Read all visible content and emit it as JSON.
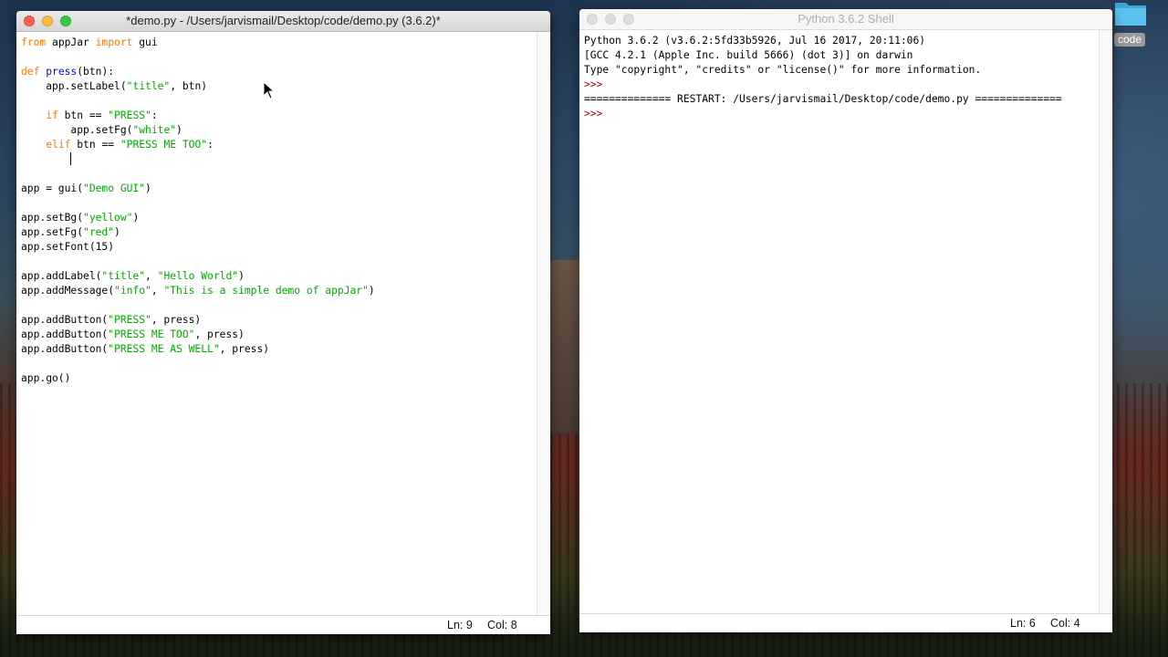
{
  "desktop": {
    "folder_label": "code"
  },
  "editor": {
    "title": "*demo.py - /Users/jarvismail/Desktop/code/demo.py (3.6.2)*",
    "lines": [
      [
        {
          "t": "from",
          "c": "kw"
        },
        {
          "t": " appJar "
        },
        {
          "t": "import",
          "c": "kw"
        },
        {
          "t": " gui"
        }
      ],
      [],
      [
        {
          "t": "def",
          "c": "kw"
        },
        {
          "t": " "
        },
        {
          "t": "press",
          "c": "def"
        },
        {
          "t": "(btn):"
        }
      ],
      [
        {
          "t": "    app.setLabel("
        },
        {
          "t": "\"title\"",
          "c": "str"
        },
        {
          "t": ", btn)"
        }
      ],
      [],
      [
        {
          "t": "    "
        },
        {
          "t": "if",
          "c": "kw"
        },
        {
          "t": " btn == "
        },
        {
          "t": "\"PRESS\"",
          "c": "str"
        },
        {
          "t": ":"
        }
      ],
      [
        {
          "t": "        app.setFg("
        },
        {
          "t": "\"white\"",
          "c": "str"
        },
        {
          "t": ")"
        }
      ],
      [
        {
          "t": "    "
        },
        {
          "t": "elif",
          "c": "kw"
        },
        {
          "t": " btn == "
        },
        {
          "t": "\"PRESS ME TOO\"",
          "c": "str"
        },
        {
          "t": ":"
        }
      ],
      [
        {
          "t": "        "
        },
        {
          "t": "",
          "c": "cursor"
        }
      ],
      [],
      [
        {
          "t": "app = gui("
        },
        {
          "t": "\"Demo GUI\"",
          "c": "str"
        },
        {
          "t": ")"
        }
      ],
      [],
      [
        {
          "t": "app.setBg("
        },
        {
          "t": "\"yellow\"",
          "c": "str"
        },
        {
          "t": ")"
        }
      ],
      [
        {
          "t": "app.setFg("
        },
        {
          "t": "\"red\"",
          "c": "str"
        },
        {
          "t": ")"
        }
      ],
      [
        {
          "t": "app.setFont(15)"
        }
      ],
      [],
      [
        {
          "t": "app.addLabel("
        },
        {
          "t": "\"title\"",
          "c": "str"
        },
        {
          "t": ", "
        },
        {
          "t": "\"Hello World\"",
          "c": "str"
        },
        {
          "t": ")"
        }
      ],
      [
        {
          "t": "app.addMessage("
        },
        {
          "t": "\"info\"",
          "c": "str"
        },
        {
          "t": ", "
        },
        {
          "t": "\"This is a simple demo of appJar\"",
          "c": "str"
        },
        {
          "t": ")"
        }
      ],
      [],
      [
        {
          "t": "app.addButton("
        },
        {
          "t": "\"PRESS\"",
          "c": "str"
        },
        {
          "t": ", press)"
        }
      ],
      [
        {
          "t": "app.addButton("
        },
        {
          "t": "\"PRESS ME TOO\"",
          "c": "str"
        },
        {
          "t": ", press)"
        }
      ],
      [
        {
          "t": "app.addButton("
        },
        {
          "t": "\"PRESS ME AS WELL\"",
          "c": "str"
        },
        {
          "t": ", press)"
        }
      ],
      [],
      [
        {
          "t": "app.go()"
        }
      ]
    ],
    "status_ln": "Ln: 9",
    "status_col": "Col: 8"
  },
  "shell": {
    "title": "Python 3.6.2 Shell",
    "lines": [
      [
        {
          "t": "Python 3.6.2 (v3.6.2:5fd33b5926, Jul 16 2017, 20:11:06)"
        }
      ],
      [
        {
          "t": "[GCC 4.2.1 (Apple Inc. build 5666) (dot 3)] on darwin"
        }
      ],
      [
        {
          "t": "Type \"copyright\", \"credits\" or \"license()\" for more information."
        }
      ],
      [
        {
          "t": ">>>",
          "c": "prompt"
        }
      ],
      [
        {
          "t": "============== RESTART: /Users/jarvismail/Desktop/code/demo.py =============="
        }
      ],
      [
        {
          "t": ">>>",
          "c": "prompt"
        }
      ]
    ],
    "status_ln": "Ln: 6",
    "status_col": "Col: 4"
  }
}
